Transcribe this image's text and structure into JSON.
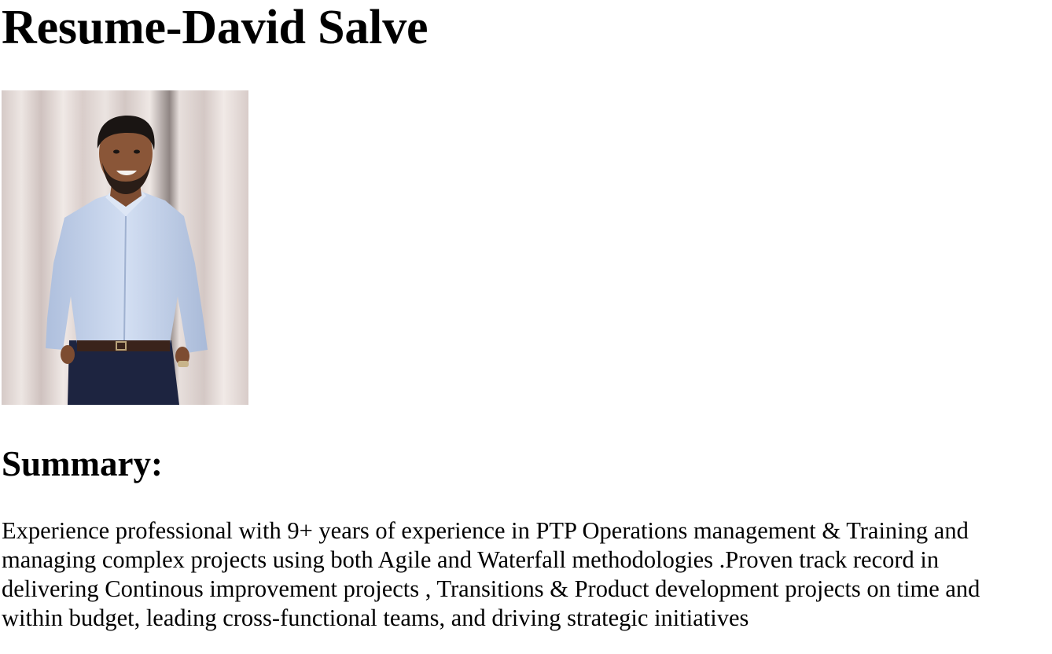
{
  "title": "Resume-David Salve",
  "photo": {
    "alt": "Photo of David Salve",
    "colors": {
      "curtain": "#e2d8d6",
      "shirt": "#c5d4ec",
      "trousers": "#1d2440",
      "skin": "#8a5638",
      "hair": "#1a1513",
      "belt": "#3a231b"
    }
  },
  "summary": {
    "heading": "Summary:",
    "text": "Experience professional with 9+ years of experience in PTP Operations management & Training and managing complex projects using both Agile and Waterfall methodologies .Proven track record in delivering Continous improvement projects , Transitions & Product development projects on time and within budget, leading cross-functional teams, and driving strategic initiatives"
  }
}
